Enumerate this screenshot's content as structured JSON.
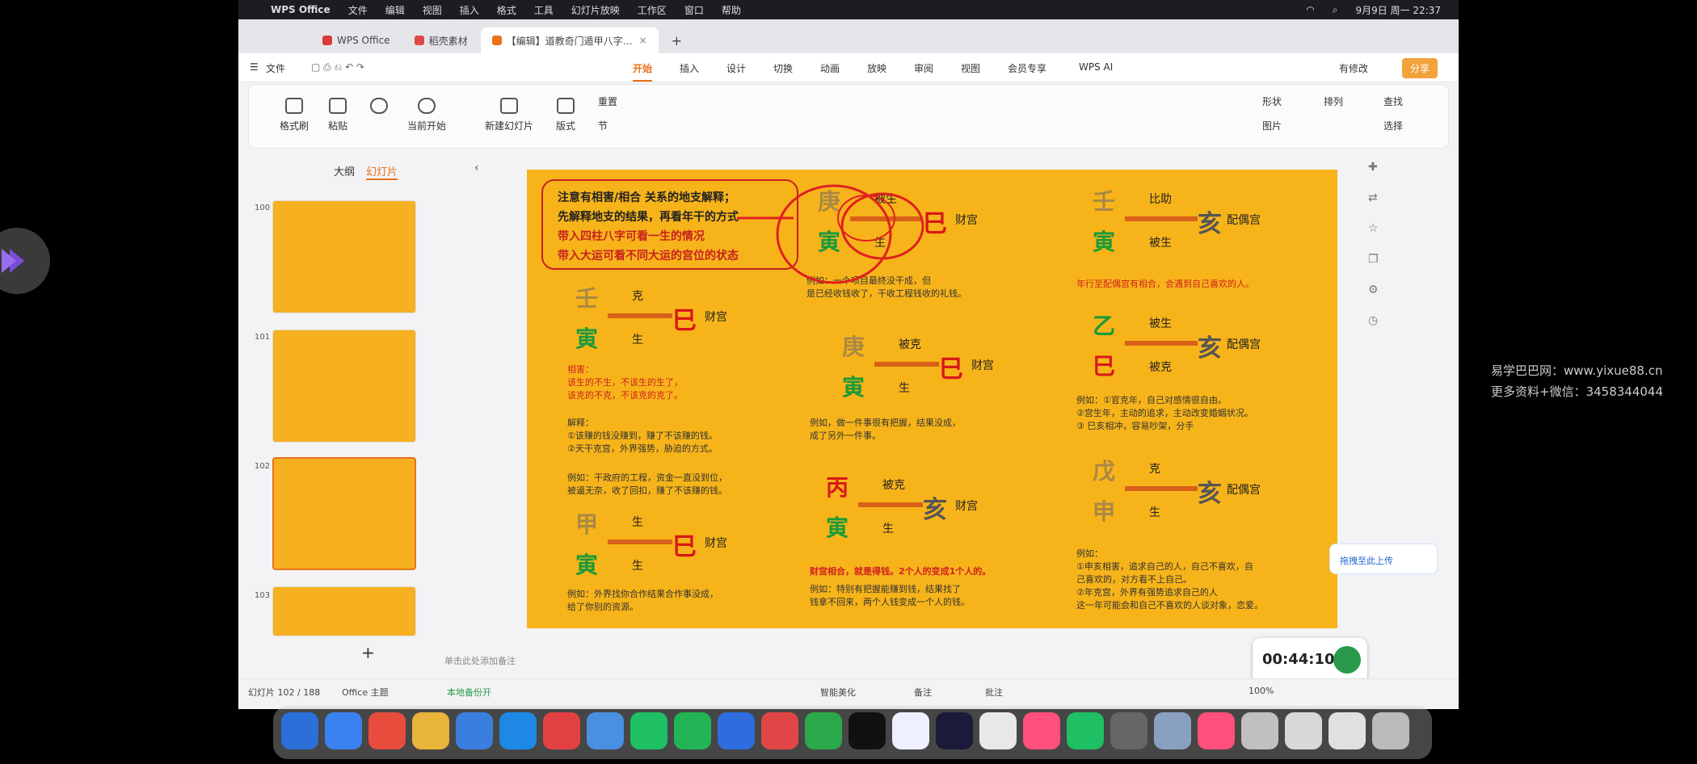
{
  "mac_menubar": {
    "app": "WPS Office",
    "menus": [
      "文件",
      "编辑",
      "视图",
      "插入",
      "格式",
      "工具",
      "幻灯片放映",
      "工作区",
      "窗口",
      "帮助"
    ],
    "clock": "9月9日 周一 22:37"
  },
  "tabs": [
    {
      "label": "WPS Office",
      "color": "#d93a3a"
    },
    {
      "label": "稻壳素材",
      "color": "#e04848"
    },
    {
      "label": "【编辑】道教奇门遁甲八字…",
      "color": "#e8731a"
    }
  ],
  "menubar": {
    "file": "文件",
    "items": [
      "开始",
      "插入",
      "设计",
      "切换",
      "动画",
      "放映",
      "审阅",
      "视图",
      "会员专享",
      "WPS AI"
    ],
    "active": "开始",
    "has_edit": "有修改",
    "share": "分享"
  },
  "ribbon": {
    "format_painter": "格式刷",
    "paste": "粘贴",
    "from_current": "当前开始",
    "new_slide": "新建幻灯片",
    "layout": "版式",
    "reset": "重置",
    "section": "节",
    "shape": "形状",
    "picture": "图片",
    "arrange": "排列",
    "find": "查找",
    "select": "选择"
  },
  "sidebar": {
    "tab_outline": "大纲",
    "tab_slides": "幻灯片",
    "slides": [
      "100",
      "101",
      "102",
      "103"
    ],
    "selected": "102"
  },
  "slide": {
    "title_lines": [
      "注意有相害/相合 关系的地支解释；",
      "先解释地支的结果，再看年干的方式",
      "带入四柱八字可看一生的情况",
      "带入大运可看不同大运的宫位的状态"
    ],
    "blocks": [
      {
        "top": "庚",
        "bottom": "寅",
        "target": "巳",
        "rel_top": "被生",
        "rel_bottom": "生",
        "palace": "财宫"
      },
      {
        "top": "壬",
        "bottom": "寅",
        "target": "亥",
        "rel_top": "比助",
        "rel_bottom": "被生",
        "palace": "配偶宫"
      },
      {
        "top": "壬",
        "bottom": "寅",
        "target": "巳",
        "rel_top": "克",
        "rel_bottom": "生",
        "palace": "财宫"
      },
      {
        "top": "庚",
        "bottom": "寅",
        "target": "巳",
        "rel_top": "被克",
        "rel_bottom": "生",
        "palace": "财宫"
      },
      {
        "top": "乙",
        "bottom": "巳",
        "target": "亥",
        "rel_top": "被生",
        "rel_bottom": "被克",
        "palace": "配偶宫"
      },
      {
        "top": "丙",
        "bottom": "寅",
        "target": "亥",
        "rel_top": "被克",
        "rel_bottom": "生",
        "palace": "财宫"
      },
      {
        "top": "戊",
        "bottom": "申",
        "target": "亥",
        "rel_top": "克",
        "rel_bottom": "生",
        "palace": "配偶宫"
      },
      {
        "top": "甲",
        "bottom": "寅",
        "target": "巳",
        "rel_top": "生",
        "rel_bottom": "生",
        "palace": "财宫"
      }
    ],
    "notes": {
      "n1": "例如：一个项目最终没干成，但\n是已经收钱收了，干收工程钱收的礼钱。",
      "n2": "年行至配偶宫有相合，会遇到自己喜欢的人。",
      "n3": "相害：\n该生的不生，不该生的生了，\n该克的不克，不该克的克了。",
      "n4": "解释：\n①该赚的钱没赚到，赚了不该赚的钱。\n②天干克宫，外界强势，胁迫的方式。",
      "n5": "例如：干政府的工程，资金一直没到位，\n被逼无奈，收了回扣，赚了不该赚的钱。",
      "n6": "例如，做一件事很有把握，结果没成，\n成了另外一件事。",
      "n7": "例如：①官克年，自己对感情很自由。\n②宫生年，主动的追求，主动改变婚姻状况。\n③ 巳亥相冲，容易吵架，分手",
      "n8": "财宫相合，就是得钱。2个人的变成1个人的。",
      "n9": "例如：特别有把握能赚到钱，结果找了\n钱拿不回来，两个人钱变成一个人的钱。",
      "n10": "例如：外界找你合作结果合作事没成，\n给了你别的资源。",
      "n11": "例如：\n①申亥相害，追求自己的人，自己不喜欢，自\n己喜欢的，对方看不上自己。\n②年克宫，外界有强势追求自己的人\n这一年可能会和自己不喜欢的人谈对象，恋爱。"
    },
    "upload_label": "拖拽至此上传"
  },
  "timer": "00:44:10",
  "notes_placeholder": "单击此处添加备注",
  "statusbar": {
    "slide_count": "幻灯片 102 / 188",
    "theme": "Office 主题",
    "backup": "本地备份开",
    "smart": "智能美化",
    "notes": "备注",
    "comment": "批注",
    "zoom": "100%"
  },
  "watermark": [
    "易学巴巴网：www.yixue88.cn",
    "更多资料+微信：3458344044"
  ],
  "dock_colors": [
    "#2b6fd8",
    "#3a82f0",
    "#e74c3c",
    "#e8b43a",
    "#3a7ee0",
    "#1e88e5",
    "#e34141",
    "#4a90e2",
    "#1fbf63",
    "#22b455",
    "#2d6de0",
    "#e04646",
    "#2ba84a",
    "#111111",
    "#eef0ff",
    "#1a1a3a",
    "#e8e8e8",
    "#ff4f7a",
    "#1fbf63",
    "#666666",
    "#8aa0c0",
    "#ff4f7a",
    "#c0c0c0",
    "#d8d8d8",
    "#e0e0e0",
    "#bbbbbb"
  ]
}
